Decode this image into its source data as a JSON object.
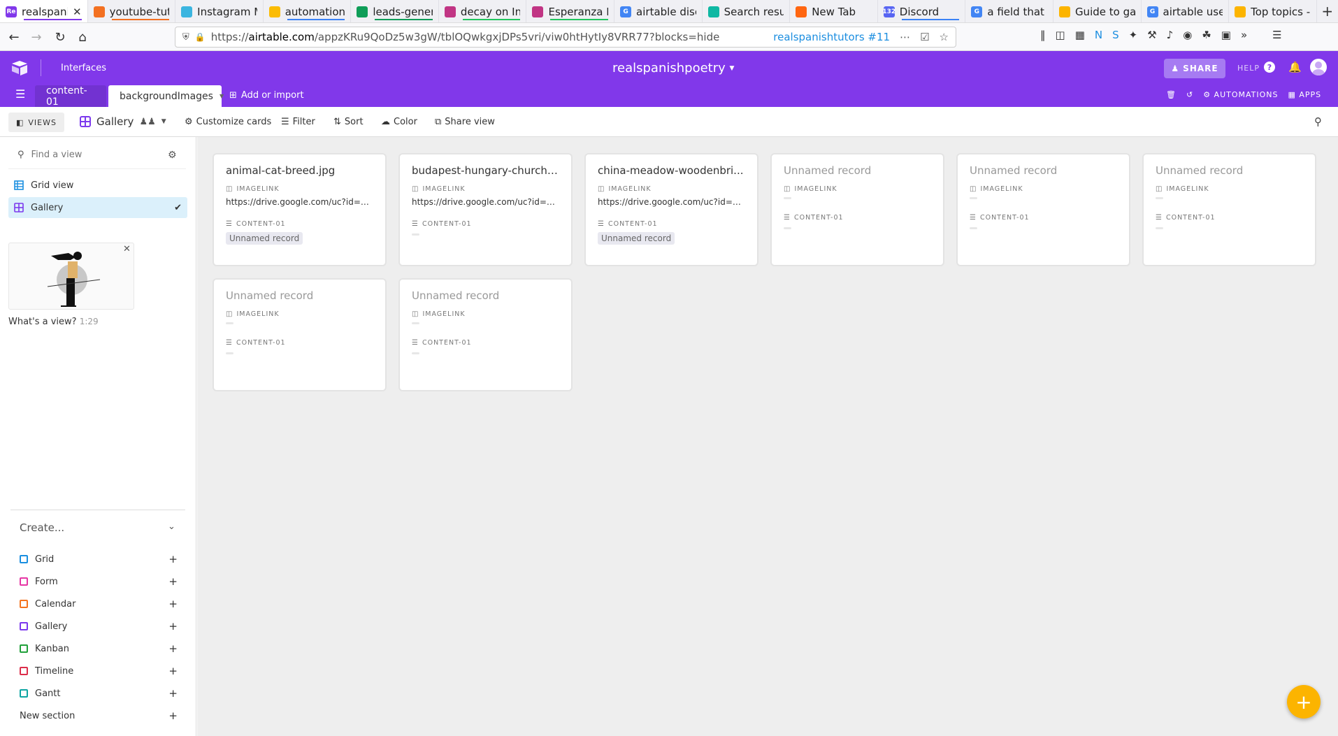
{
  "browser": {
    "tabs": [
      {
        "label": "realspanis",
        "color": "#8138ea",
        "fav": "Re",
        "underline": "#8138ea"
      },
      {
        "label": "youtube-tuto",
        "color": "#f37021",
        "fav": "",
        "underline": "#f37021"
      },
      {
        "label": "Instagram M",
        "color": "#3bb5e0",
        "fav": "",
        "underline": ""
      },
      {
        "label": "automations",
        "color": "#fbbc04",
        "fav": "",
        "underline": "#3b82f6"
      },
      {
        "label": "leads-gener",
        "color": "#0f9d58",
        "fav": "",
        "underline": "#0f9d58"
      },
      {
        "label": "decay on Ins",
        "color": "#c13584",
        "fav": "",
        "underline": "#22c55e"
      },
      {
        "label": "Esperanza R",
        "color": "#c13584",
        "fav": "",
        "underline": "#22c55e"
      },
      {
        "label": "airtable disc",
        "color": "#4285f4",
        "fav": "G",
        "underline": ""
      },
      {
        "label": "Search resul",
        "color": "#0fb8a3",
        "fav": "",
        "underline": ""
      },
      {
        "label": "New Tab",
        "color": "#ff6611",
        "fav": "",
        "underline": ""
      },
      {
        "label": "Discord",
        "color": "#5865f2",
        "fav": "132",
        "underline": "#3b82f6"
      },
      {
        "label": "a field that d",
        "color": "#4285f4",
        "fav": "G",
        "underline": ""
      },
      {
        "label": "Guide to gal",
        "color": "#fcb400",
        "fav": "",
        "underline": ""
      },
      {
        "label": "airtable user",
        "color": "#4285f4",
        "fav": "G",
        "underline": ""
      },
      {
        "label": "Top topics -",
        "color": "#fcb400",
        "fav": "",
        "underline": ""
      }
    ],
    "url_prefix": "https://",
    "url_domain": "airtable.com",
    "url_rest": "/appzKRu9QoDz5w3gW/tblOQwkgxjDPs5vri/viw0htHytIy8VRR77?blocks=hide",
    "url_badge": "realspanishtutors #11"
  },
  "header": {
    "interfaces": "Interfaces",
    "base_title": "realspanishpoetry",
    "share": "SHARE",
    "help": "HELP",
    "tables": [
      "content-01",
      "backgroundImages"
    ],
    "add_import": "Add or import",
    "automations": "AUTOMATIONS",
    "apps": "APPS"
  },
  "toolbar": {
    "views": "VIEWS",
    "current_view": "Gallery",
    "customize": "Customize cards",
    "filter": "Filter",
    "sort": "Sort",
    "color": "Color",
    "share_view": "Share view"
  },
  "sidebar": {
    "find_placeholder": "Find a view",
    "views": [
      {
        "label": "Grid view",
        "selected": false
      },
      {
        "label": "Gallery",
        "selected": true
      }
    ],
    "video_caption": "What's a view?",
    "video_duration": "1:29",
    "create": "Create...",
    "create_items": [
      {
        "label": "Grid",
        "color": "#1a8fe0"
      },
      {
        "label": "Form",
        "color": "#e636a4"
      },
      {
        "label": "Calendar",
        "color": "#f4741f"
      },
      {
        "label": "Gallery",
        "color": "#7c39ed"
      },
      {
        "label": "Kanban",
        "color": "#20a03a"
      },
      {
        "label": "Timeline",
        "color": "#dc2d4a"
      },
      {
        "label": "Gantt",
        "color": "#0ea5a3"
      },
      {
        "label": "New section",
        "color": ""
      }
    ]
  },
  "cards": {
    "field1": "IMAGELINK",
    "field2": "CONTENT-01",
    "unnamed": "Unnamed record",
    "records": [
      {
        "title": "animal-cat-breed.jpg",
        "named": true,
        "imagelink": "https://drive.google.com/uc?id=1-...",
        "content": "Unnamed record"
      },
      {
        "title": "budapest-hungary-church.j...",
        "named": true,
        "imagelink": "https://drive.google.com/uc?id=1...",
        "content": ""
      },
      {
        "title": "china-meadow-woodenbri...",
        "named": true,
        "imagelink": "https://drive.google.com/uc?id=1n...",
        "content": "Unnamed record"
      },
      {
        "title": "Unnamed record",
        "named": false,
        "imagelink": "",
        "content": ""
      },
      {
        "title": "Unnamed record",
        "named": false,
        "imagelink": "",
        "content": ""
      },
      {
        "title": "Unnamed record",
        "named": false,
        "imagelink": "",
        "content": ""
      },
      {
        "title": "Unnamed record",
        "named": false,
        "imagelink": "",
        "content": ""
      },
      {
        "title": "Unnamed record",
        "named": false,
        "imagelink": "",
        "content": ""
      }
    ]
  }
}
